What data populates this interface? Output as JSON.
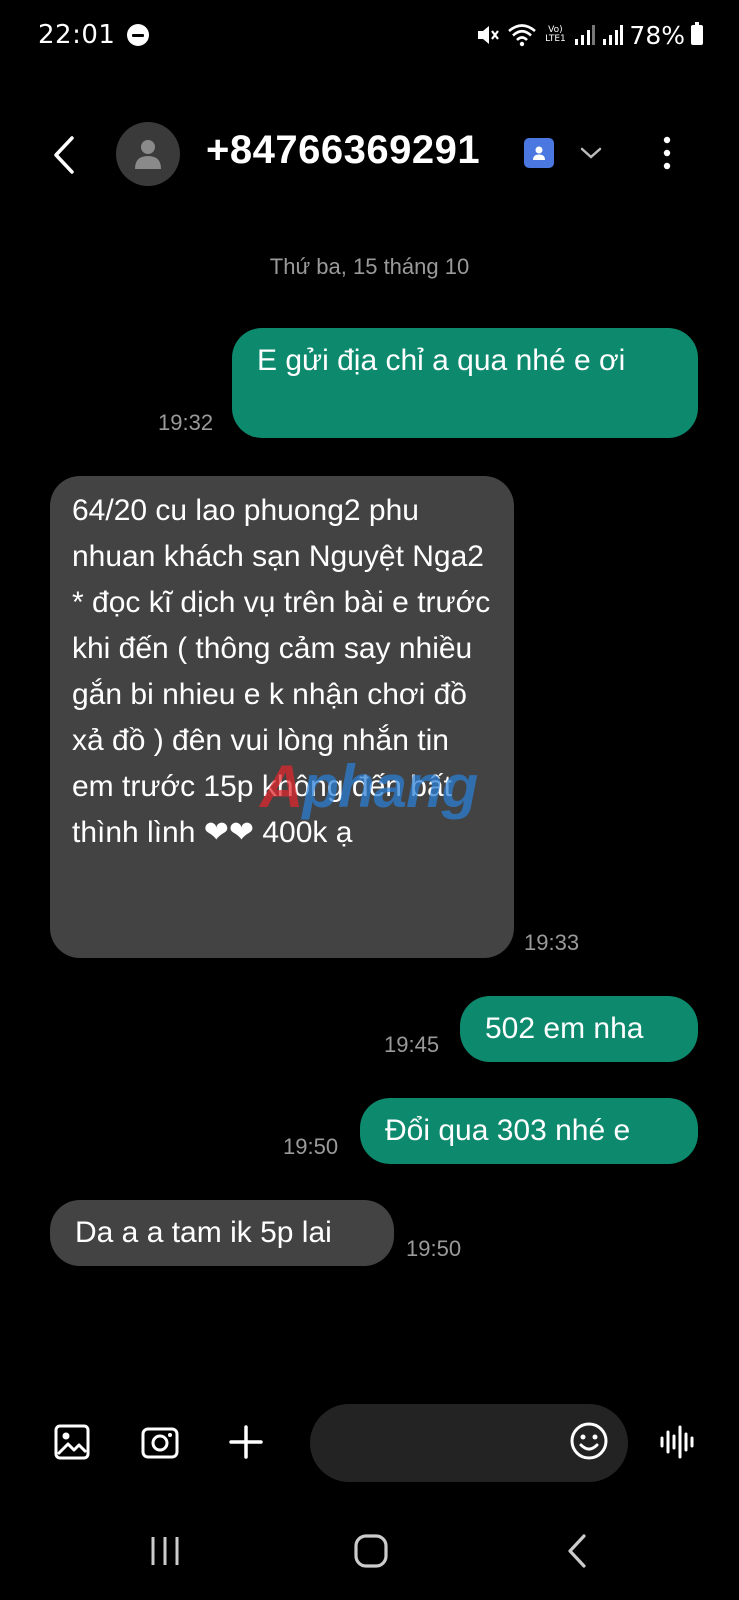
{
  "status_bar": {
    "time": "22:01",
    "battery": "78%",
    "network_badge": "Vo) LTE1"
  },
  "header": {
    "contact": "+84766369291"
  },
  "conversation": {
    "date_separator": "Thứ ba, 15 tháng 10",
    "messages": [
      {
        "direction": "outgoing",
        "text": "E gửi địa chỉ a qua nhé e ơi",
        "time": "19:32"
      },
      {
        "direction": "incoming",
        "text": "64/20 cu lao phuong2 phu nhuan khách sạn Nguyệt Nga2 * đọc kĩ dịch vụ trên bài e trước khi đến ( thông cảm say nhiều gắn bi nhieu e k nhận chơi đồ xả đồ ) đên vui lòng nhắn tin em trước 15p không đến bất thình lình ❤❤  400k ạ",
        "time": "19:33"
      },
      {
        "direction": "outgoing",
        "text": "502 em nha",
        "time": "19:45"
      },
      {
        "direction": "outgoing",
        "text": "Đổi qua 303 nhé e",
        "time": "19:50"
      },
      {
        "direction": "incoming",
        "text": "Da a a tam ik 5p lai",
        "time": "19:50"
      }
    ]
  },
  "watermark": {
    "part1": "A",
    "part2": "phang"
  },
  "composer": {
    "placeholder": ""
  },
  "colors": {
    "outgoing_bubble": "#0d8a6e",
    "incoming_bubble": "#434343",
    "background": "#000000",
    "timestamp": "#9a9a9a"
  },
  "icons": [
    "back-arrow-icon",
    "avatar-icon",
    "contact-card-icon",
    "chevron-down-icon",
    "more-vert-icon",
    "gallery-icon",
    "camera-icon",
    "plus-icon",
    "emoji-icon",
    "voice-waveform-icon",
    "recents-icon",
    "home-icon",
    "back-nav-icon"
  ]
}
